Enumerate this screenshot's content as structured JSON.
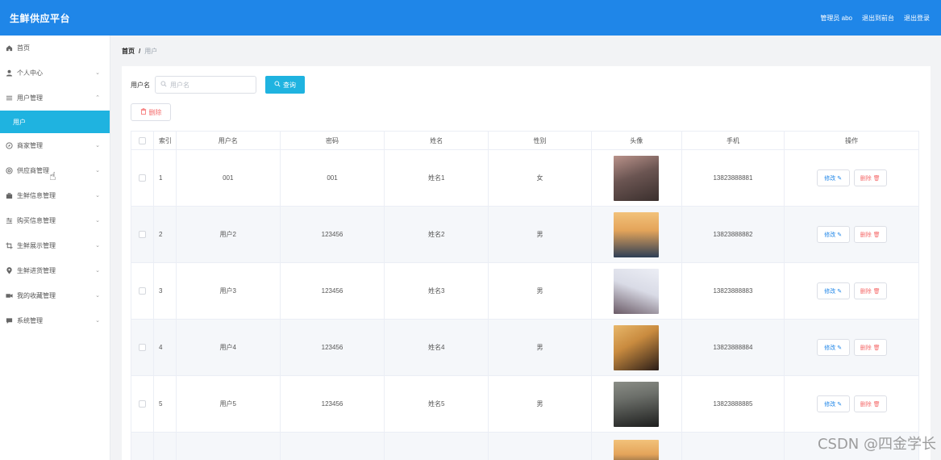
{
  "header": {
    "brand": "生鲜供应平台",
    "admin_label": "管理员 abo",
    "to_front": "退出到前台",
    "logout": "退出登录"
  },
  "sidebar": {
    "items": [
      {
        "label": "首页",
        "icon": "home-icon",
        "chevron": false
      },
      {
        "label": "个人中心",
        "icon": "user-icon",
        "chevron": true
      },
      {
        "label": "用户管理",
        "icon": "menu-icon",
        "chevron": true
      }
    ],
    "active_sub": "用户",
    "items_after": [
      {
        "label": "商家管理",
        "icon": "compass-icon",
        "chevron": true
      },
      {
        "label": "供应商管理",
        "icon": "support-icon",
        "chevron": true
      },
      {
        "label": "生鲜信息管理",
        "icon": "briefcase-icon",
        "chevron": true
      },
      {
        "label": "购买信息管理",
        "icon": "sliders-icon",
        "chevron": true
      },
      {
        "label": "生鲜展示管理",
        "icon": "crop-icon",
        "chevron": true
      },
      {
        "label": "生鲜进货管理",
        "icon": "location-icon",
        "chevron": true
      },
      {
        "label": "我的收藏管理",
        "icon": "video-icon",
        "chevron": true
      },
      {
        "label": "系统管理",
        "icon": "chat-icon",
        "chevron": true
      }
    ]
  },
  "breadcrumb": {
    "home": "首页",
    "sep": "/",
    "current": "用户"
  },
  "search": {
    "label": "用户名",
    "placeholder": "用户名",
    "button": "查询"
  },
  "actions": {
    "delete": "删除"
  },
  "table": {
    "headers": [
      "索引",
      "用户名",
      "密码",
      "姓名",
      "性别",
      "头像",
      "手机",
      "操作"
    ],
    "rows": [
      {
        "index": "1",
        "username": "001",
        "password": "001",
        "name": "姓名1",
        "gender": "女",
        "phone": "13823888881",
        "avatar_colors": [
          "#3a2f2d",
          "#b9928a"
        ]
      },
      {
        "index": "2",
        "username": "用户2",
        "password": "123456",
        "name": "姓名2",
        "gender": "男",
        "phone": "13823888882",
        "avatar_colors": [
          "#e4a45a",
          "#2e3e55"
        ]
      },
      {
        "index": "3",
        "username": "用户3",
        "password": "123456",
        "name": "姓名3",
        "gender": "男",
        "phone": "13823888883",
        "avatar_colors": [
          "#d9dbe6",
          "#6a5a66"
        ]
      },
      {
        "index": "4",
        "username": "用户4",
        "password": "123456",
        "name": "姓名4",
        "gender": "男",
        "phone": "13823888884",
        "avatar_colors": [
          "#c98b3f",
          "#2a1d18"
        ]
      },
      {
        "index": "5",
        "username": "用户5",
        "password": "123456",
        "name": "姓名5",
        "gender": "男",
        "phone": "13823888885",
        "avatar_colors": [
          "#1e1f1e",
          "#6c6f6a"
        ]
      }
    ],
    "edit_label": "修改",
    "delete_label": "删除"
  },
  "watermark": "CSDN @四金学长",
  "colors": {
    "topbar": "#1f86e8",
    "accent": "#1fb3e0",
    "danger": "#f56c6c"
  }
}
